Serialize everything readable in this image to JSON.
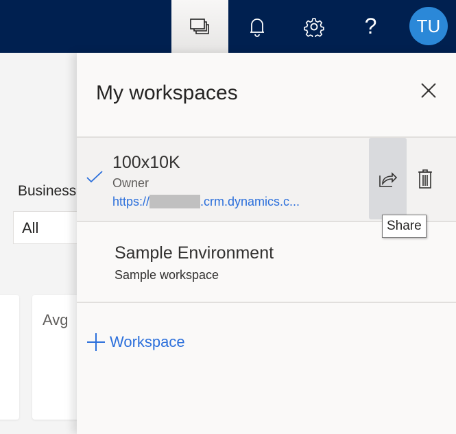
{
  "topbar": {
    "avatar_initials": "TU",
    "icons": [
      "workspaces-icon",
      "bell-icon",
      "gear-icon",
      "help-icon"
    ]
  },
  "background": {
    "filter_label": "Business",
    "filter_value": "All",
    "card_label": "Avg"
  },
  "panel": {
    "title": "My workspaces",
    "workspaces": [
      {
        "name": "100x10K",
        "role": "Owner",
        "url_prefix": "https://",
        "url_suffix": ".crm.dynamics.c...",
        "selected": true
      },
      {
        "name": "Sample Environment",
        "subtitle": "Sample workspace"
      }
    ],
    "tooltip": "Share",
    "add_label": "Workspace"
  },
  "colors": {
    "topbar": "#002050",
    "accent": "#2b6fdb",
    "avatar": "#2b88d8"
  }
}
